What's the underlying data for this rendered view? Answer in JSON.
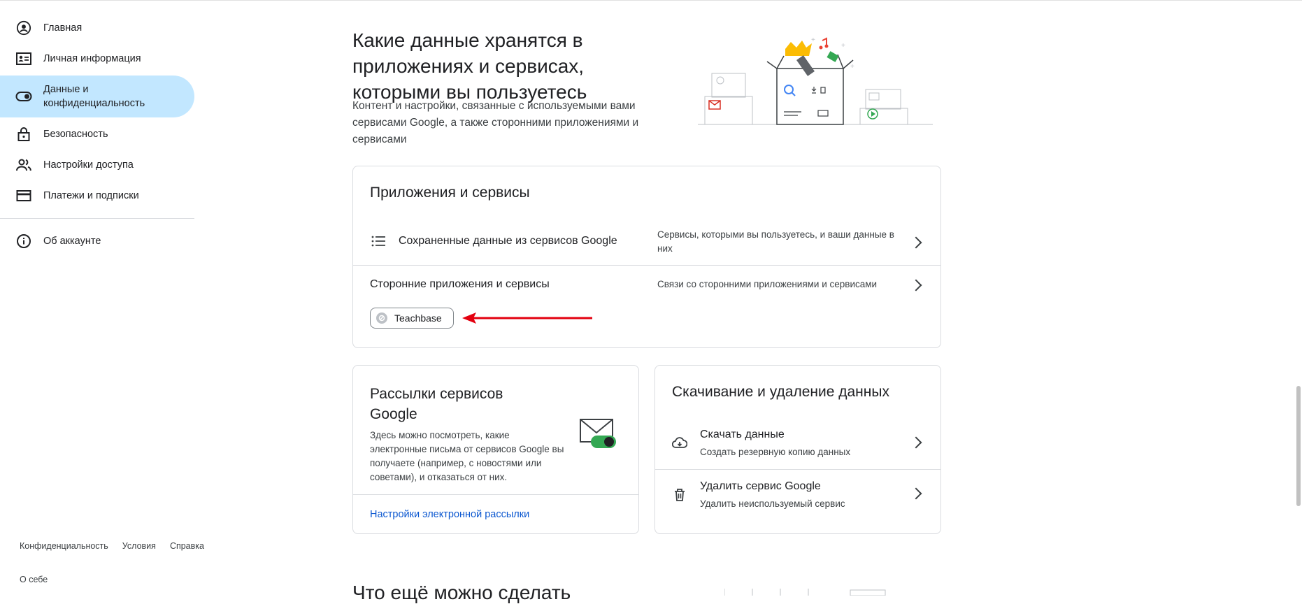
{
  "sidebar": {
    "items": [
      {
        "label": "Главная",
        "icon": "account-circle-icon"
      },
      {
        "label": "Личная информация",
        "icon": "id-card-icon"
      },
      {
        "label": "Данные и конфиденциальность",
        "icon": "toggle-icon"
      },
      {
        "label": "Безопасность",
        "icon": "lock-icon"
      },
      {
        "label": "Настройки доступа",
        "icon": "people-icon"
      },
      {
        "label": "Платежи и подписки",
        "icon": "credit-card-icon"
      }
    ],
    "about": {
      "label": "Об аккаунте",
      "icon": "info-icon"
    },
    "footer": [
      "Конфиденциальность",
      "Условия",
      "Справка"
    ],
    "footer_about": "О себе",
    "active_color": "#c2e7ff"
  },
  "main": {
    "title": "Какие данные хранятся в приложениях и сервисах, которыми вы пользуетесь",
    "subtitle": "Контент и настройки, связанные с используемыми вами сервисами Google, а также сторонними приложениями и сервисами",
    "apps_card": {
      "title": "Приложения и сервисы",
      "rows": [
        {
          "label": "Сохраненные данные из сервисов Google",
          "desc": "Сервисы, которыми вы пользуетесь, и ваши данные в них",
          "icon": "list-icon"
        },
        {
          "label": "Сторонние приложения и сервисы",
          "desc": "Связи со сторонними приложениями и сервисами"
        }
      ],
      "chip": "Teachbase"
    },
    "newsletter_card": {
      "title": "Рассылки сервисов Google",
      "desc": "Здесь можно посмотреть, какие электронные письма от сервисов Google вы получаете (например, с новостями или советами), и отказаться от них.",
      "link": "Настройки электронной рассылки"
    },
    "download_card": {
      "title": "Скачивание и удаление данных",
      "rows": [
        {
          "label": "Скачать данные",
          "desc": "Создать резервную копию данных",
          "icon": "cloud-download-icon"
        },
        {
          "label": "Удалить сервис Google",
          "desc": "Удалить неиспользуемый сервис",
          "icon": "trash-icon"
        }
      ]
    },
    "bottom_title": "Что ещё можно сделать",
    "arrow_color": "#e3000f",
    "link_color": "#0b57d0"
  }
}
